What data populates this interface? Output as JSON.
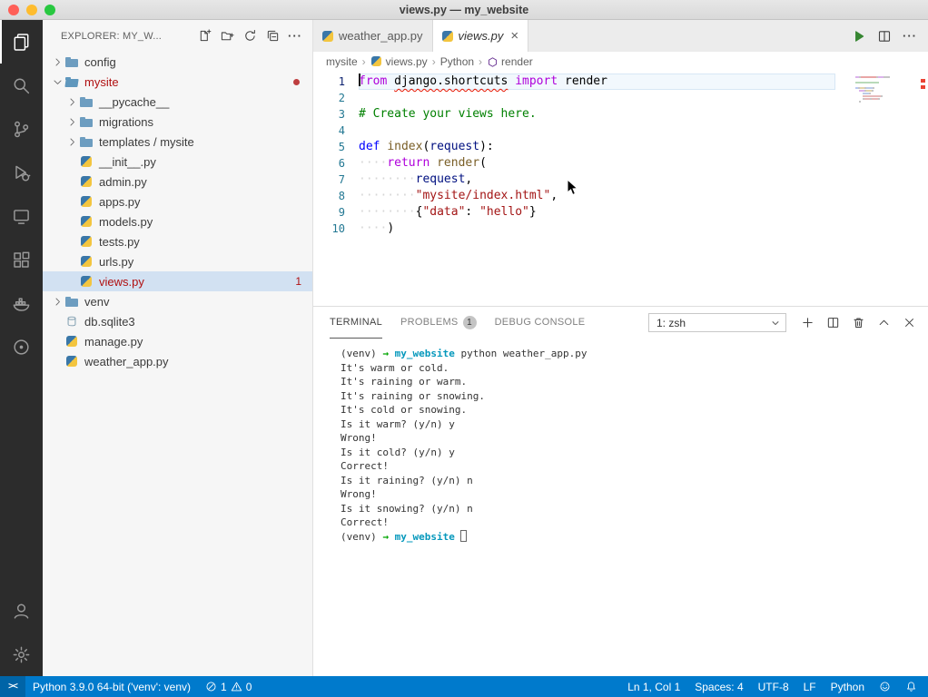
{
  "window": {
    "title": "views.py — my_website"
  },
  "colors": {
    "accent": "#007acc",
    "error": "#b01011",
    "keyword": "#af00db",
    "string": "#a31515",
    "comment": "#008000"
  },
  "activity_bar": {
    "items": [
      {
        "name": "explorer",
        "active": true
      },
      {
        "name": "search"
      },
      {
        "name": "source-control"
      },
      {
        "name": "run-debug"
      },
      {
        "name": "remote-explorer"
      },
      {
        "name": "extensions"
      },
      {
        "name": "docker"
      },
      {
        "name": "test-explorer"
      },
      {
        "name": "accounts",
        "bottom": true
      },
      {
        "name": "settings",
        "bottom": true
      }
    ]
  },
  "explorer": {
    "title": "EXPLORER: MY_W...",
    "actions": [
      "new-file",
      "new-folder",
      "refresh",
      "collapse-all",
      "more"
    ],
    "tree": [
      {
        "label": "config",
        "icon": "folder",
        "indent": 0,
        "chevron": "collapsed"
      },
      {
        "label": "mysite",
        "icon": "folder-open",
        "indent": 0,
        "chevron": "expanded",
        "error_dot": true,
        "color": "error"
      },
      {
        "label": "__pycache__",
        "icon": "folder",
        "indent": 1,
        "chevron": "collapsed"
      },
      {
        "label": "migrations",
        "icon": "folder",
        "indent": 1,
        "chevron": "collapsed"
      },
      {
        "label": "templates / mysite",
        "icon": "folder",
        "indent": 1,
        "chevron": "collapsed"
      },
      {
        "label": "__init__.py",
        "icon": "python",
        "indent": 1
      },
      {
        "label": "admin.py",
        "icon": "python",
        "indent": 1
      },
      {
        "label": "apps.py",
        "icon": "python",
        "indent": 1
      },
      {
        "label": "models.py",
        "icon": "python",
        "indent": 1
      },
      {
        "label": "tests.py",
        "icon": "python",
        "indent": 1
      },
      {
        "label": "urls.py",
        "icon": "python",
        "indent": 1
      },
      {
        "label": "views.py",
        "icon": "python",
        "indent": 1,
        "selected": true,
        "badge": "1",
        "color": "error"
      },
      {
        "label": "venv",
        "icon": "folder",
        "indent": 0,
        "chevron": "collapsed"
      },
      {
        "label": "db.sqlite3",
        "icon": "database",
        "indent": 0
      },
      {
        "label": "manage.py",
        "icon": "python",
        "indent": 0
      },
      {
        "label": "weather_app.py",
        "icon": "python",
        "indent": 0
      }
    ]
  },
  "editor": {
    "tabs": [
      {
        "label": "weather_app.py",
        "icon": "python"
      },
      {
        "label": "views.py",
        "icon": "python",
        "active": true,
        "italic": true,
        "close": true
      }
    ],
    "actions": [
      "run",
      "split-editor",
      "more"
    ],
    "breadcrumbs": [
      {
        "label": "mysite"
      },
      {
        "label": "views.py",
        "icon": "python"
      },
      {
        "label": "Python"
      },
      {
        "label": "render",
        "icon": "symbol"
      }
    ],
    "lines": [
      {
        "num": "1",
        "current": true,
        "tokens": [
          [
            "from",
            "k"
          ],
          [
            " ",
            "p"
          ],
          [
            "django.shortcuts",
            "e"
          ],
          [
            " ",
            "p"
          ],
          [
            "import",
            "k"
          ],
          [
            " render",
            "p"
          ]
        ]
      },
      {
        "num": "2",
        "tokens": []
      },
      {
        "num": "3",
        "tokens": [
          [
            "# Create your views here.",
            "c"
          ]
        ]
      },
      {
        "num": "4",
        "tokens": []
      },
      {
        "num": "5",
        "tokens": [
          [
            "def",
            "d"
          ],
          [
            " ",
            "p"
          ],
          [
            "index",
            "f"
          ],
          [
            "(",
            "p"
          ],
          [
            "request",
            "v"
          ],
          [
            "):",
            "p"
          ]
        ]
      },
      {
        "num": "6",
        "tokens": [
          [
            "····",
            "w"
          ],
          [
            "return",
            "k"
          ],
          [
            " ",
            "p"
          ],
          [
            "render",
            "f"
          ],
          [
            "(",
            "p"
          ]
        ]
      },
      {
        "num": "7",
        "tokens": [
          [
            "········",
            "w"
          ],
          [
            "request",
            "v"
          ],
          [
            ",",
            "p"
          ]
        ]
      },
      {
        "num": "8",
        "tokens": [
          [
            "········",
            "w"
          ],
          [
            "\"mysite/index.html\"",
            "s"
          ],
          [
            ",",
            "p"
          ]
        ]
      },
      {
        "num": "9",
        "tokens": [
          [
            "········",
            "w"
          ],
          [
            "{",
            "p"
          ],
          [
            "\"data\"",
            "s"
          ],
          [
            ": ",
            "p"
          ],
          [
            "\"hello\"",
            "s"
          ],
          [
            "}",
            "p"
          ]
        ]
      },
      {
        "num": "10",
        "tokens": [
          [
            "····",
            "w"
          ],
          [
            ")",
            "p"
          ]
        ]
      }
    ]
  },
  "panel": {
    "tabs": [
      {
        "label": "TERMINAL",
        "active": true
      },
      {
        "label": "PROBLEMS",
        "badge": "1"
      },
      {
        "label": "DEBUG CONSOLE"
      }
    ],
    "shell_selector": "1: zsh",
    "actions": [
      "new-terminal",
      "split-terminal",
      "kill-terminal",
      "maximize-panel",
      "close-panel"
    ],
    "terminal": [
      [
        [
          "(venv) ",
          "p"
        ],
        [
          "→",
          "g"
        ],
        [
          "  ",
          "p"
        ],
        [
          "my_website",
          "t"
        ],
        [
          " python weather_app.py",
          "p"
        ]
      ],
      [
        [
          "It's warm or cold.",
          "p"
        ]
      ],
      [
        [
          "It's raining or warm.",
          "p"
        ]
      ],
      [
        [
          "It's raining or snowing.",
          "p"
        ]
      ],
      [
        [
          "It's cold or snowing.",
          "p"
        ]
      ],
      [
        [
          "Is it warm? (y/n) y",
          "p"
        ]
      ],
      [
        [
          "Wrong!",
          "p"
        ]
      ],
      [
        [
          "Is it cold? (y/n) y",
          "p"
        ]
      ],
      [
        [
          "Correct!",
          "p"
        ]
      ],
      [
        [
          "Is it raining? (y/n) n",
          "p"
        ]
      ],
      [
        [
          "Wrong!",
          "p"
        ]
      ],
      [
        [
          "Is it snowing? (y/n) n",
          "p"
        ]
      ],
      [
        [
          "Correct!",
          "p"
        ]
      ],
      [
        [
          "(venv) ",
          "p"
        ],
        [
          "→",
          "g"
        ],
        [
          "  ",
          "p"
        ],
        [
          "my_website",
          "t"
        ],
        [
          " ",
          "p"
        ],
        [
          "",
          "cursor"
        ]
      ]
    ]
  },
  "status_bar": {
    "remote_label": "><",
    "left": [
      {
        "name": "interpreter",
        "label": "Python 3.9.0 64-bit ('venv': venv)"
      },
      {
        "name": "problems",
        "error_count": "1",
        "warning_count": "0"
      }
    ],
    "right": [
      {
        "name": "cursor-position",
        "label": "Ln 1, Col 1"
      },
      {
        "name": "indentation",
        "label": "Spaces: 4"
      },
      {
        "name": "encoding",
        "label": "UTF-8"
      },
      {
        "name": "eol",
        "label": "LF"
      },
      {
        "name": "language",
        "label": "Python"
      },
      {
        "name": "feedback",
        "icon": "smiley"
      },
      {
        "name": "notifications",
        "icon": "bell"
      }
    ]
  }
}
